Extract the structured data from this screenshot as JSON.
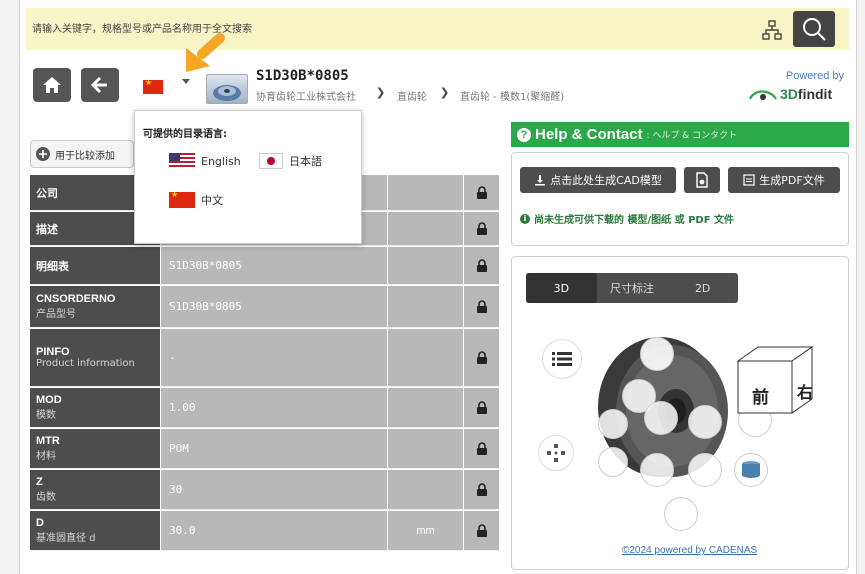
{
  "search": {
    "placeholder": "请输入关键字，规格型号或产品名称用于全文搜索"
  },
  "icons": {
    "tree": "tree-view-icon",
    "search": "search-icon",
    "home": "home-icon",
    "back": "back-arrow-icon",
    "flag": "china-flag-icon",
    "caret": "caret-down-icon",
    "compare": "compare-icon",
    "lock": "lock-icon"
  },
  "header": {
    "title": "S1D30B*0805",
    "breadcrumb": [
      "协育齿轮工业株式会社",
      "直齿轮",
      "直齿轮 - 模数1(聚缩醛)"
    ],
    "powered_by": "Powered by",
    "brand_3d": "3D",
    "brand_findit": "findit"
  },
  "language_menu": {
    "title": "可提供的目录语言:",
    "options": [
      {
        "label": "English",
        "flag": "us-flag-icon"
      },
      {
        "label": "日本語",
        "flag": "japan-flag-icon"
      },
      {
        "label": "中文",
        "flag": "china-flag-icon"
      }
    ]
  },
  "compare_button": "用于比较添加",
  "properties": [
    {
      "key": "公司",
      "sub": "",
      "value": "",
      "unit": ""
    },
    {
      "key": "描述",
      "sub": "",
      "value": "",
      "unit": ""
    },
    {
      "key": "明细表",
      "sub": "",
      "value": "S1D30B*0805",
      "unit": ""
    },
    {
      "key": "CNSORDERNO",
      "sub": "产品型号",
      "value": "S1D30B*0805",
      "unit": ""
    },
    {
      "key": "PINFO",
      "sub": "Product information",
      "value": "-",
      "unit": ""
    },
    {
      "key": "MOD",
      "sub": "模数",
      "value": "1.00",
      "unit": ""
    },
    {
      "key": "MTR",
      "sub": "材料",
      "value": "POM",
      "unit": ""
    },
    {
      "key": "Z",
      "sub": "齿数",
      "value": "30",
      "unit": ""
    },
    {
      "key": "D",
      "sub": "基准圆直径 d",
      "value": "30.0",
      "unit": "mm"
    }
  ],
  "help": {
    "title": "Help & Contact",
    "subtitle": ": ヘルプ & コンタクト"
  },
  "cad": {
    "generate_cad": "点击此处生成CAD模型",
    "generate_pdf": "生成PDF文件",
    "notice": "尚未生成可供下载的 模型/图纸 或 PDF 文件"
  },
  "viewer": {
    "tabs": [
      "3D",
      "尺寸标注",
      "2D"
    ],
    "cube_front": "前",
    "cube_right": "右",
    "footer": "©2024 powered by CADENAS"
  },
  "colors": {
    "accent_green": "#2aa84a",
    "dark_button": "#4d4d4d",
    "search_bg": "#f7f4c6",
    "arrow_orange": "#f5a623"
  }
}
